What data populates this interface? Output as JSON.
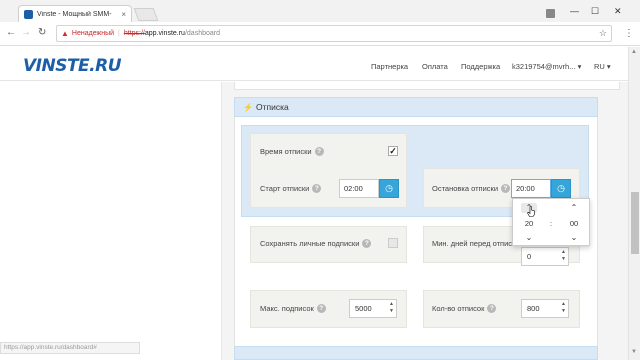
{
  "browser": {
    "tab_title": "Vinste - Мощный SMM-",
    "tab_close": "×",
    "insecure_label": "Ненадежный",
    "url_proto": "https://",
    "url_host": "app.vinste.ru",
    "url_path": "/dashboard",
    "status_url": "https://app.vinste.ru/dashboard#"
  },
  "header": {
    "logo": "VINSTE.RU",
    "nav": {
      "partner": "Партнерка",
      "payment": "Оплата",
      "support": "Поддержка",
      "account": "k3219754@mvrh... ▾",
      "language": "RU ▾"
    }
  },
  "panel": {
    "title": "Отписка"
  },
  "fields": {
    "unfollow_time": {
      "label": "Время отписки",
      "checked": true,
      "check_mark": "✓"
    },
    "unfollow_start": {
      "label": "Старт отписки",
      "value": "02:00"
    },
    "unfollow_stop": {
      "label": "Остановка отписки",
      "value": "20:00"
    },
    "keep_personal": {
      "label": "Сохранять личные подписки",
      "checked": false
    },
    "min_days": {
      "label": "Мин. дней перед отписк",
      "value": "0"
    },
    "max_follows": {
      "label": "Макс. подписок",
      "value": "5000"
    },
    "unfollow_count": {
      "label": "Кол-во отписок",
      "value": "800"
    }
  },
  "timepicker": {
    "hours": "20",
    "minutes": "00",
    "colon": ":"
  },
  "icons": {
    "help": "?",
    "clock": "◷",
    "up": "⌃",
    "down": "⌄"
  }
}
